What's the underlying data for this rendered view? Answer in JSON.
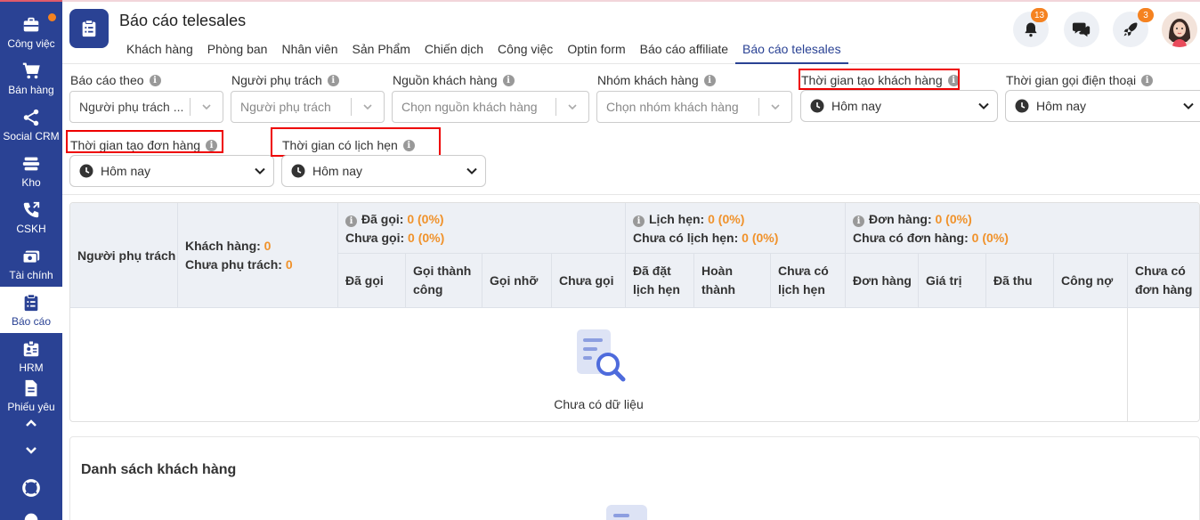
{
  "sidebar": {
    "items": [
      {
        "label": "Công việc",
        "icon": "briefcase-icon"
      },
      {
        "label": "Bán hàng",
        "icon": "cart-icon"
      },
      {
        "label": "Social CRM",
        "icon": "share-icon"
      },
      {
        "label": "Kho",
        "icon": "warehouse-icon"
      },
      {
        "label": "CSKH",
        "icon": "phone-icon"
      },
      {
        "label": "Tài chính",
        "icon": "money-icon"
      },
      {
        "label": "Báo cáo",
        "icon": "clipboard-icon"
      },
      {
        "label": "HRM",
        "icon": "id-card-icon"
      },
      {
        "label": "Phiếu yêu",
        "icon": "document-icon"
      }
    ],
    "active": "Báo cáo"
  },
  "header": {
    "title": "Báo cáo telesales",
    "tabs": [
      "Khách hàng",
      "Phòng ban",
      "Nhân viên",
      "Sản Phẩm",
      "Chiến dịch",
      "Công việc",
      "Optin form",
      "Báo cáo affiliate",
      "Báo cáo telesales"
    ],
    "active_tab": "Báo cáo telesales",
    "notifications_count": "13",
    "rocket_count": "3"
  },
  "filters": {
    "report_by": {
      "label": "Báo cáo theo",
      "value": "Người phụ trách ..."
    },
    "owner": {
      "label": "Người phụ trách",
      "placeholder": "Người phụ trách"
    },
    "source": {
      "label": "Nguồn khách hàng",
      "placeholder": "Chọn nguồn khách hàng"
    },
    "group": {
      "label": "Nhóm khách hàng",
      "placeholder": "Chọn nhóm khách hàng"
    },
    "customer_created": {
      "label": "Thời gian tạo khách hàng",
      "value": "Hôm nay"
    },
    "call_time": {
      "label": "Thời gian gọi điện thoại",
      "value": "Hôm nay"
    },
    "order_created": {
      "label": "Thời gian tạo đơn hàng",
      "value": "Hôm nay"
    },
    "appointment_time": {
      "label": "Thời gian có lịch hẹn",
      "value": "Hôm nay"
    }
  },
  "table": {
    "col_owner": "Người phụ trách",
    "customers_label": "Khách hàng:",
    "customers_value": "0",
    "unassigned_label": "Chưa phụ trách:",
    "unassigned_value": "0",
    "called_label": "Đã gọi:",
    "called_value": "0 (0%)",
    "not_called_label": "Chưa gọi:",
    "not_called_value": "0 (0%)",
    "appt_label": "Lịch hẹn:",
    "appt_value": "0 (0%)",
    "no_appt_label": "Chưa có lịch hẹn:",
    "no_appt_value": "0 (0%)",
    "orders_label": "Đơn hàng:",
    "orders_value": "0 (0%)",
    "no_orders_label": "Chưa có đơn hàng:",
    "no_orders_value": "0 (0%)",
    "sub_headers": [
      "Đã gọi",
      "Gọi thành công",
      "Gọi nhỡ",
      "Chưa gọi",
      "Đã đặt lịch hẹn",
      "Hoàn thành",
      "Chưa có lịch hẹn",
      "Đơn hàng",
      "Giá trị",
      "Đã thu",
      "Công nợ",
      "Chưa có đơn hàng"
    ],
    "empty_text": "Chưa có dữ liệu"
  },
  "customer_list": {
    "title": "Danh sách khách hàng"
  },
  "colors": {
    "primary": "#2a4294",
    "accent": "#f58220",
    "highlight": "#e00000"
  }
}
